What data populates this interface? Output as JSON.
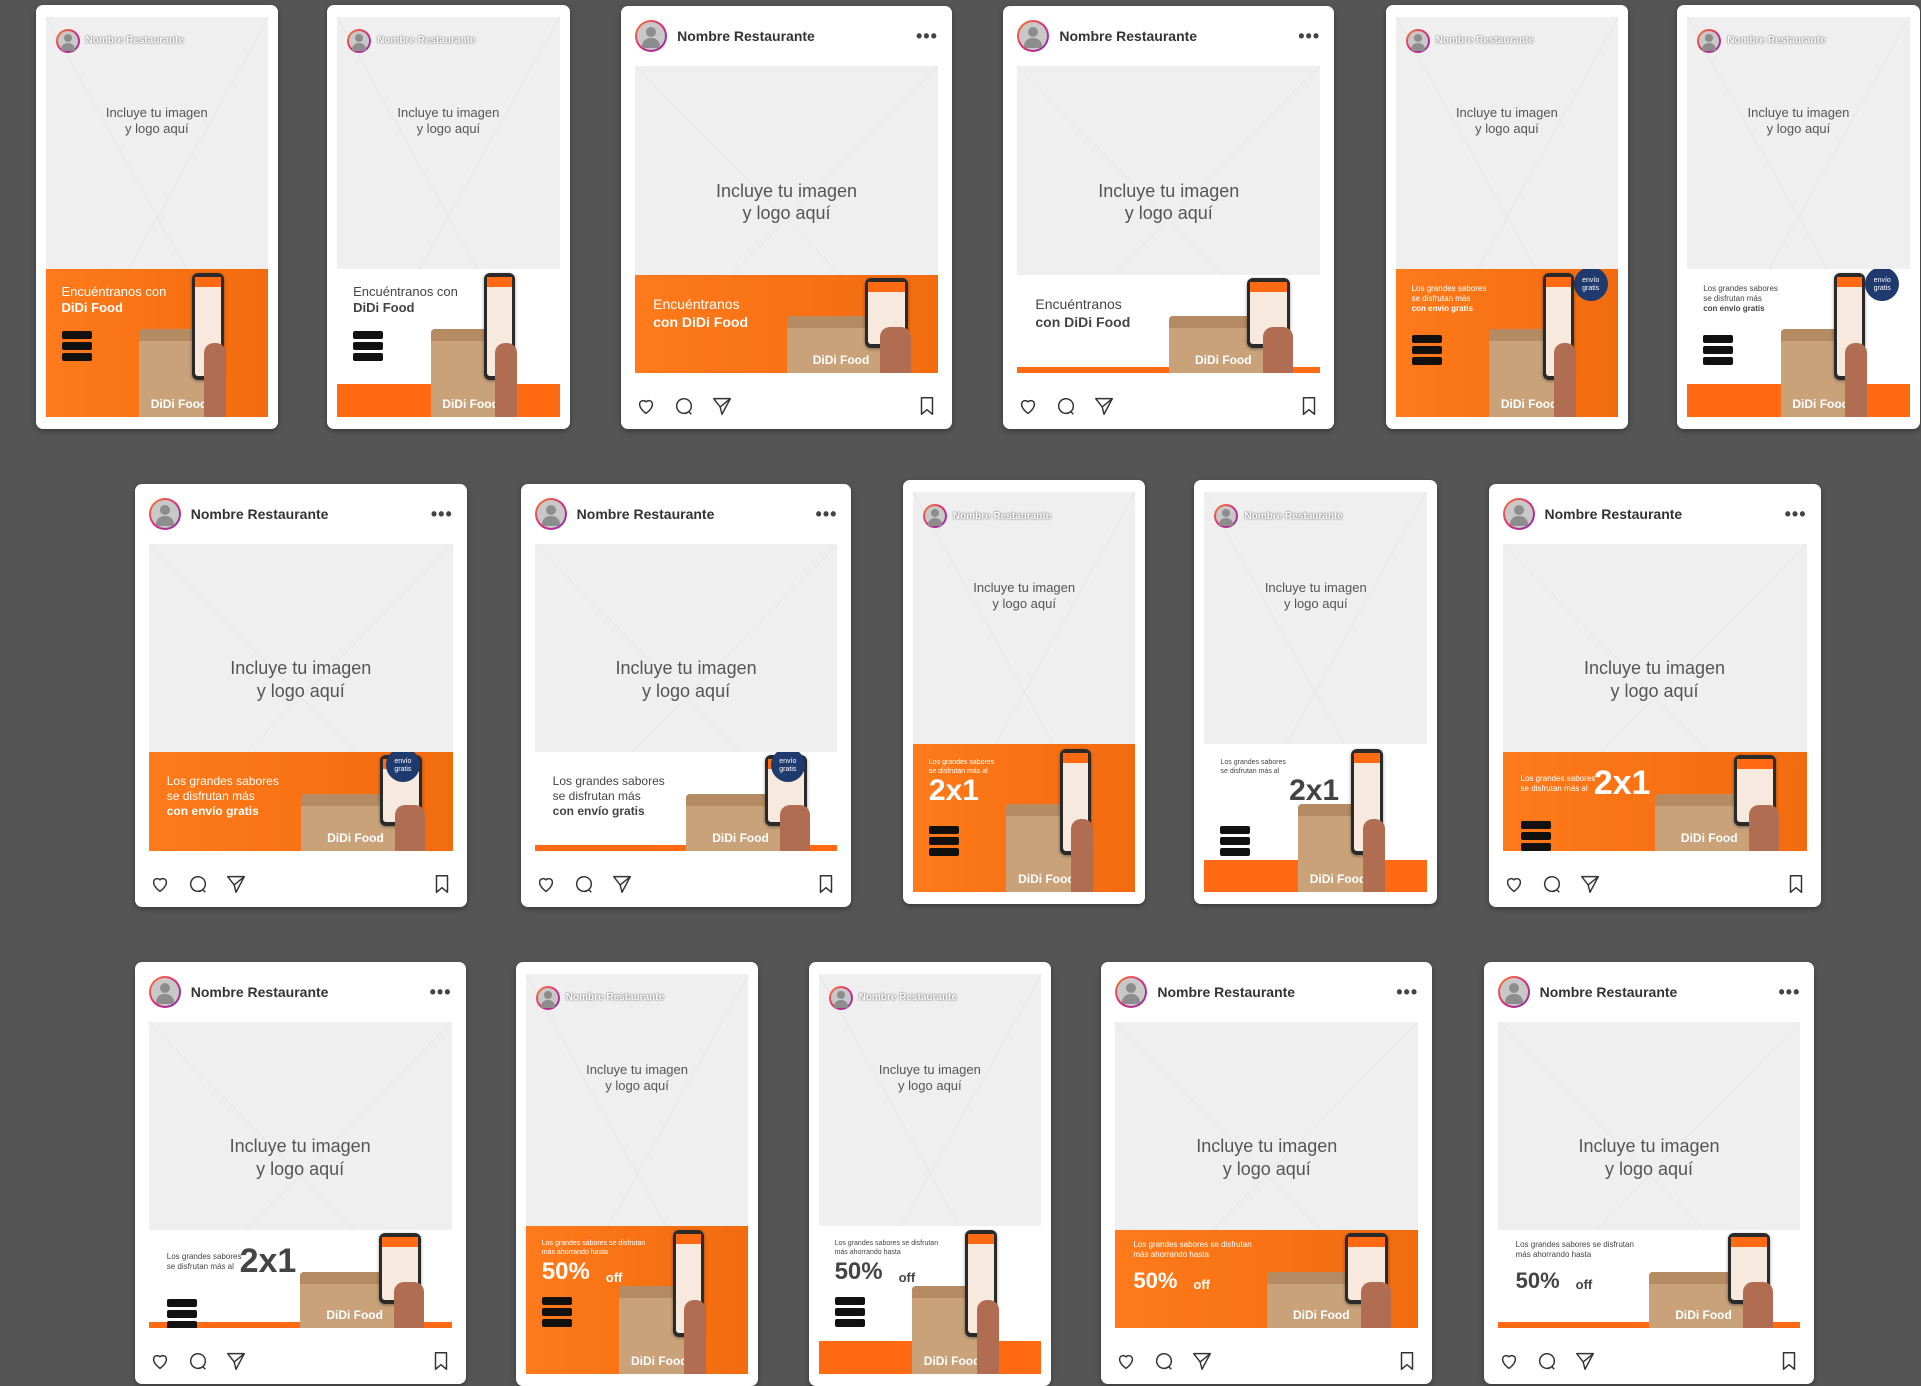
{
  "placeholder_text": [
    "Incluye tu imagen",
    "y logo aquí"
  ],
  "profile_name": "Nombre Restaurante",
  "menu_dots": "•••",
  "brand": "DiDi Food",
  "copy": {
    "find_us": [
      "Encuéntranos con",
      "DiDi Food"
    ],
    "find_us_post": [
      "Encuéntranos",
      "con DiDi Food"
    ],
    "free_delivery": [
      "Los grandes sabores",
      "se disfrutan más",
      "con envío gratis"
    ],
    "badge_free": [
      "envío",
      "gratis"
    ],
    "two_for_one_lead": [
      "Los grandes sabores",
      "se disfrutan más al"
    ],
    "two_for_one": "2x1",
    "half_off_lead": [
      "Los grandes sabores se disfrutan",
      "más ahorrando hasta"
    ],
    "half_off": "50%",
    "half_off_suffix": "off"
  },
  "colors": {
    "background": "#555555",
    "accent": "#ff6a13",
    "navy": "#1e3a6e"
  },
  "icons": [
    "heart-icon",
    "comment-icon",
    "share-icon",
    "bookmark-icon"
  ]
}
